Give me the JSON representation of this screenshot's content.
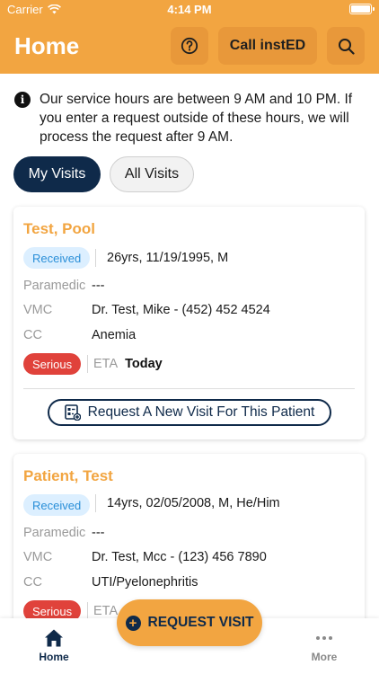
{
  "status_bar": {
    "carrier": "Carrier",
    "time": "4:14 PM"
  },
  "header": {
    "title": "Home",
    "call_label": "Call instED",
    "icons": {
      "help": "help-circle-icon",
      "search": "search-icon"
    },
    "color": "#f2a541"
  },
  "notice": {
    "text": "Our service hours are between 9 AM and 10 PM. If you enter a request outside of these hours, we will process the request after 9 AM.",
    "icon": "info-icon"
  },
  "tabs": [
    {
      "label": "My Visits",
      "selected": true
    },
    {
      "label": "All Visits",
      "selected": false
    }
  ],
  "visits": [
    {
      "name": "Test, Pool",
      "status": "Received",
      "demographics": "26yrs, 11/19/1995, M",
      "paramedic_label": "Paramedic",
      "paramedic": "---",
      "vmc_label": "VMC",
      "vmc": "Dr. Test, Mike - (452) 452 4524",
      "cc_label": "CC",
      "cc": "Anemia",
      "severity": "Serious",
      "eta_label": "ETA",
      "eta": "Today",
      "request_label": "Request A New Visit For This Patient"
    },
    {
      "name": "Patient, Test",
      "status": "Received",
      "demographics": "14yrs, 02/05/2008, M, He/Him",
      "paramedic_label": "Paramedic",
      "paramedic": "---",
      "vmc_label": "VMC",
      "vmc": "Dr. Test, Mcc - (123) 456 7890",
      "cc_label": "CC",
      "cc": "UTI/Pyelonephritis",
      "severity": "Serious",
      "eta_label": "ETA"
    }
  ],
  "fab": {
    "label": "REQUEST VISIT",
    "icon": "plus-circle-icon"
  },
  "bottom_nav": [
    {
      "label": "Home",
      "icon": "home-icon",
      "active": true
    },
    {
      "label": "More",
      "icon": "more-dots-icon",
      "active": false
    }
  ],
  "colors": {
    "accent": "#f2a541",
    "navy": "#0f2a4a",
    "serious": "#e0423b",
    "received_bg": "#dcefff"
  }
}
